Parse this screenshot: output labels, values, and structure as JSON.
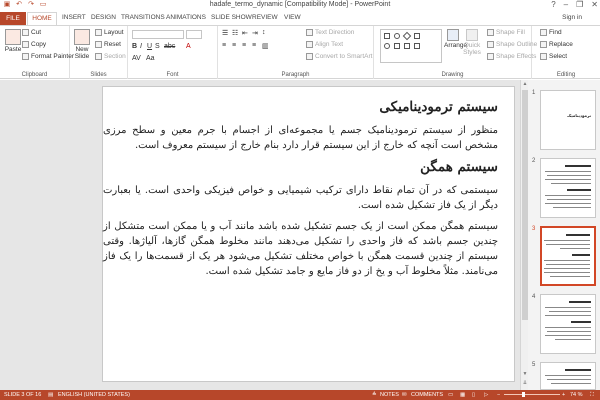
{
  "window": {
    "title": "hadafe_termo_dynamic [Compatibility Mode] - PowerPoint"
  },
  "qat": {
    "save_icon": "save-icon",
    "undo_icon": "undo-icon",
    "redo_icon": "redo-icon",
    "present_icon": "present-icon"
  },
  "window_controls": {
    "help": "?",
    "minimize": "–",
    "restore": "❐",
    "close": "✕"
  },
  "tabs": [
    "FILE",
    "HOME",
    "INSERT",
    "DESIGN",
    "TRANSITIONS",
    "ANIMATIONS",
    "SLIDE SHOW",
    "REVIEW",
    "VIEW"
  ],
  "user": {
    "signin": "Sign in"
  },
  "ribbon": {
    "clipboard": {
      "paste": "Paste",
      "cut": "Cut",
      "copy": "Copy",
      "format_painter": "Format Painter",
      "label": "Clipboard"
    },
    "slides": {
      "new_slide": "New Slide",
      "layout": "Layout",
      "reset": "Reset",
      "section": "Section",
      "label": "Slides"
    },
    "font": {
      "label": "Font"
    },
    "paragraph": {
      "text_direction": "Text Direction",
      "align_text": "Align Text",
      "convert_smartart": "Convert to SmartArt",
      "label": "Paragraph"
    },
    "drawing": {
      "arrange": "Arrange",
      "quick_styles": "Quick Styles",
      "shape_fill": "Shape Fill",
      "shape_outline": "Shape Outline",
      "shape_effects": "Shape Effects",
      "label": "Drawing"
    },
    "editing": {
      "find": "Find",
      "replace": "Replace",
      "select": "Select",
      "label": "Editing"
    }
  },
  "slide": {
    "heading1": "سیستم ترمودینامیکی",
    "para1": "منظور از سیستم ترمودینامیک جسم یا مجموعه‌ای از اجسام با جرم معین و سطح مرزی مشخص است آنچه که خارج از این سیستم قرار دارد بنام خارج از سیستم معروف است.",
    "heading2": "سیستم همگن",
    "para2": "سیستمی که در آن تمام نقاط دارای ترکیب شیمیایی و خواص فیزیکی واحدی است. یا بعبارت دیگر از یک فاز تشکیل شده است.",
    "para3": "سیستم همگن ممکن است از یک جسم تشکیل شده باشد مانند آب و یا ممکن است متشکل از چندین جسم باشد که فاز واحدی را تشکیل می‌دهند مانند مخلوط همگن گازها، آلیاژها. وقتی سیستم از چندین قسمت همگن با خواص مختلف تشکیل می‌شود هر یک از قسمت‌ها را یک فاز می‌نامند. مثلاً مخلوط آب و یخ از دو فاز مایع و جامد تشکیل شده است."
  },
  "thumbnails": {
    "numbers": [
      "1",
      "2",
      "3",
      "4",
      "5"
    ],
    "slide1_title": "ترمودینامیک",
    "selected_index": 3
  },
  "status": {
    "slide_of": "SLIDE 3 OF 16",
    "language": "ENGLISH (UNITED STATES)",
    "notes": "NOTES",
    "comments": "COMMENTS",
    "zoom": "74 %",
    "zoom_percent": 74
  },
  "colors": {
    "accent": "#b7472a",
    "selection": "#d24726"
  }
}
